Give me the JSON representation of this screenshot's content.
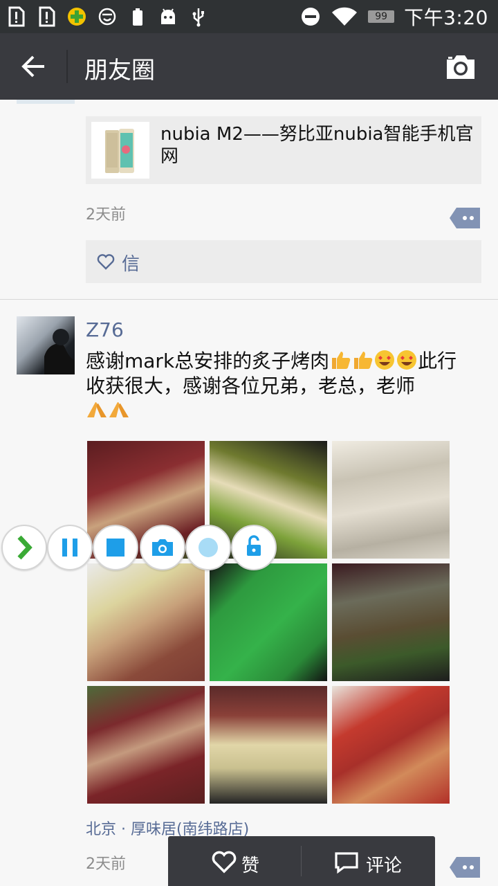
{
  "status_bar": {
    "time": "下午3:20",
    "battery": "99",
    "icons": [
      "sim-alert-icon",
      "sim-alert-icon",
      "add-app-icon",
      "smile-face-icon",
      "battery-icon",
      "android-icon",
      "usb-icon",
      "do-not-disturb-icon",
      "wifi-icon"
    ]
  },
  "toolbar": {
    "title": "朋友圈",
    "back_icon": "arrow-left-icon",
    "camera_icon": "camera-icon"
  },
  "previous_post": {
    "link_title": "nubia M2——努比亚nubia智能手机官网",
    "time": "2天前",
    "likes": "信"
  },
  "post": {
    "username": "Z76",
    "text_a": "感谢mark总安排的炙子烤肉",
    "text_b": "此行收获很大，感谢各位兄弟，老总，老师",
    "location": "北京 · 厚味居(南纬路店)",
    "time": "2天前",
    "photo_count": 9
  },
  "floating_toolbar": {
    "buttons": [
      "expand-icon",
      "pause-icon",
      "stop-icon",
      "screenshot-icon",
      "record-icon",
      "unlock-icon"
    ]
  },
  "action_bar": {
    "like_label": "赞",
    "comment_label": "评论"
  },
  "colors": {
    "status_bar": "#2f3234",
    "toolbar": "#393a3f",
    "link_blue": "#576b95",
    "float_blue": "#1e9ee8"
  }
}
